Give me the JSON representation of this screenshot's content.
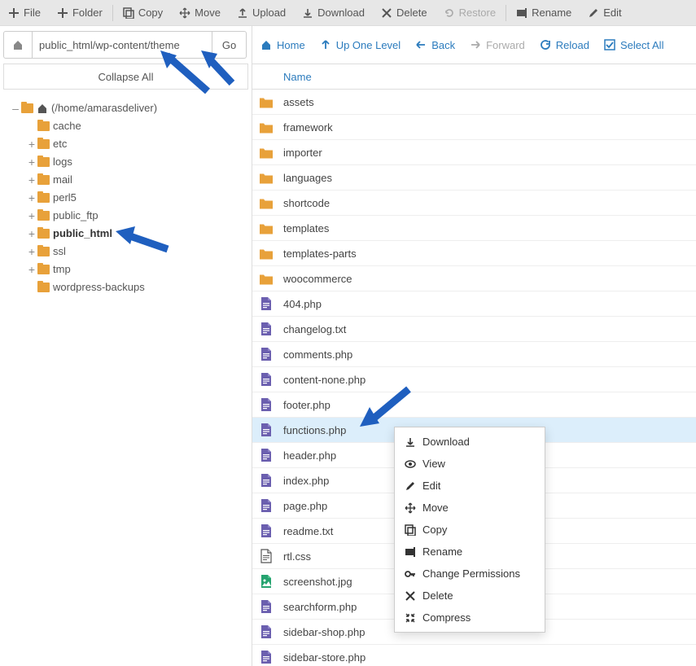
{
  "toolbar": {
    "file": "File",
    "folder": "Folder",
    "copy": "Copy",
    "move": "Move",
    "upload": "Upload",
    "download": "Download",
    "delete": "Delete",
    "restore": "Restore",
    "rename": "Rename",
    "edit": "Edit"
  },
  "path_input": "public_html/wp-content/theme",
  "go_label": "Go",
  "collapse_label": "Collapse All",
  "tree_root_label": "(/home/amarasdeliver)",
  "tree_items": [
    {
      "label": "cache",
      "expander": ""
    },
    {
      "label": "etc",
      "expander": "+"
    },
    {
      "label": "logs",
      "expander": "+"
    },
    {
      "label": "mail",
      "expander": "+"
    },
    {
      "label": "perl5",
      "expander": "+"
    },
    {
      "label": "public_ftp",
      "expander": "+"
    },
    {
      "label": "public_html",
      "expander": "+",
      "bold": true
    },
    {
      "label": "ssl",
      "expander": "+"
    },
    {
      "label": "tmp",
      "expander": "+"
    },
    {
      "label": "wordpress-backups",
      "expander": ""
    }
  ],
  "right_toolbar": {
    "home": "Home",
    "up": "Up One Level",
    "back": "Back",
    "forward": "Forward",
    "reload": "Reload",
    "select_all": "Select All"
  },
  "column_name": "Name",
  "files": [
    {
      "name": "assets",
      "type": "folder"
    },
    {
      "name": "framework",
      "type": "folder"
    },
    {
      "name": "importer",
      "type": "folder"
    },
    {
      "name": "languages",
      "type": "folder"
    },
    {
      "name": "shortcode",
      "type": "folder"
    },
    {
      "name": "templates",
      "type": "folder"
    },
    {
      "name": "templates-parts",
      "type": "folder"
    },
    {
      "name": "woocommerce",
      "type": "folder"
    },
    {
      "name": "404.php",
      "type": "php"
    },
    {
      "name": "changelog.txt",
      "type": "txt"
    },
    {
      "name": "comments.php",
      "type": "php"
    },
    {
      "name": "content-none.php",
      "type": "php"
    },
    {
      "name": "footer.php",
      "type": "php"
    },
    {
      "name": "functions.php",
      "type": "php",
      "selected": true
    },
    {
      "name": "header.php",
      "type": "php"
    },
    {
      "name": "index.php",
      "type": "php"
    },
    {
      "name": "page.php",
      "type": "php"
    },
    {
      "name": "readme.txt",
      "type": "txt"
    },
    {
      "name": "rtl.css",
      "type": "css"
    },
    {
      "name": "screenshot.jpg",
      "type": "img"
    },
    {
      "name": "searchform.php",
      "type": "php"
    },
    {
      "name": "sidebar-shop.php",
      "type": "php"
    },
    {
      "name": "sidebar-store.php",
      "type": "php"
    }
  ],
  "context_menu": {
    "download": "Download",
    "view": "View",
    "edit": "Edit",
    "move": "Move",
    "copy": "Copy",
    "rename": "Rename",
    "perms": "Change Permissions",
    "delete": "Delete",
    "compress": "Compress"
  }
}
